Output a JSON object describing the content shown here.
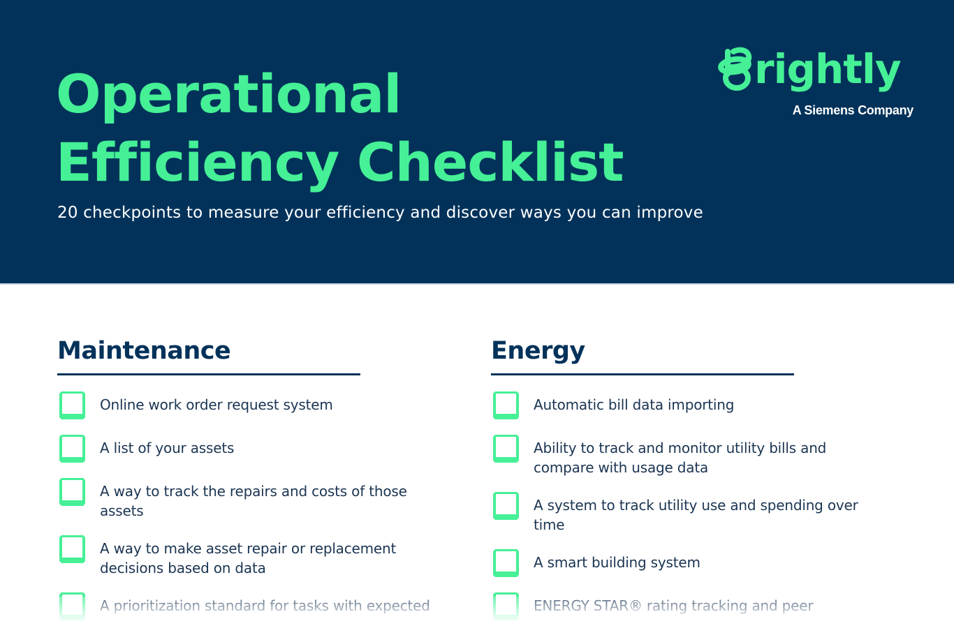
{
  "header": {
    "title_line1": "Operational",
    "title_line2": "Efficiency Checklist",
    "subtitle": "20 checkpoints to measure your efficiency and discover ways you can improve",
    "logo": {
      "wordmark": "rightly",
      "mark_icon": "brightly-b-loop-icon",
      "tagline": "A Siemens Company"
    }
  },
  "colors": {
    "navy": "#02325a",
    "green": "#45f096",
    "text": "#1b3552"
  },
  "sections": [
    {
      "heading": "Maintenance",
      "items": [
        {
          "label": "Online work order request system",
          "checked": false
        },
        {
          "label": "A list of your assets",
          "checked": false
        },
        {
          "label": "A way to track the repairs and costs of those assets",
          "checked": false
        },
        {
          "label": "A way to make asset repair or replacement decisions based on data",
          "checked": false
        },
        {
          "label": "A prioritization standard for tasks with expected",
          "checked": false
        }
      ]
    },
    {
      "heading": "Energy",
      "items": [
        {
          "label": "Automatic bill data importing",
          "checked": false
        },
        {
          "label": "Ability to track and monitor utility bills and compare with usage data",
          "checked": false
        },
        {
          "label": "A system to track utility use and spending over time",
          "checked": false
        },
        {
          "label": "A smart building system",
          "checked": false
        },
        {
          "label": "ENERGY STAR® rating tracking and peer",
          "checked": false
        }
      ]
    }
  ]
}
